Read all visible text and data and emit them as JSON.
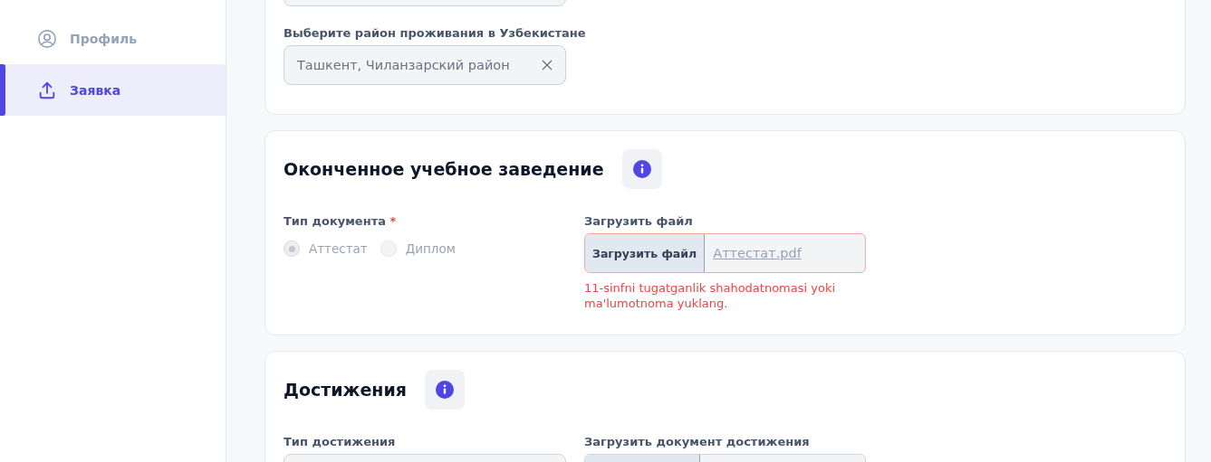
{
  "sidebar": {
    "items": [
      {
        "label": "Профиль",
        "selected": false
      },
      {
        "label": "Заявка",
        "selected": true
      }
    ]
  },
  "residence_card": {
    "fields": [
      {
        "kind": "select"
      },
      {
        "kind": "select",
        "label": "Выберите район проживания в Узбекистане",
        "value": "Ташкент, Чиланзарский район",
        "clearable": true
      }
    ]
  },
  "education_card": {
    "title": "Оконченное учебное заведение",
    "document_type": {
      "label": "Тип документа",
      "required_mark": "*",
      "disabled": true,
      "options": [
        {
          "label": "Аттестат",
          "selected": true
        },
        {
          "label": "Диплом",
          "selected": false
        }
      ]
    },
    "file": {
      "label": "Загрузить файл",
      "button": "Загрузить файл",
      "file_name": "Аттестат.pdf",
      "error": "11-sinfni tugatganlik shahodatnomasi yoki ma'lumotnoma yuklang."
    }
  },
  "achievements_card": {
    "title": "Достижения",
    "type_label": "Тип достижения",
    "file_label": "Загрузить документ достижения"
  }
}
